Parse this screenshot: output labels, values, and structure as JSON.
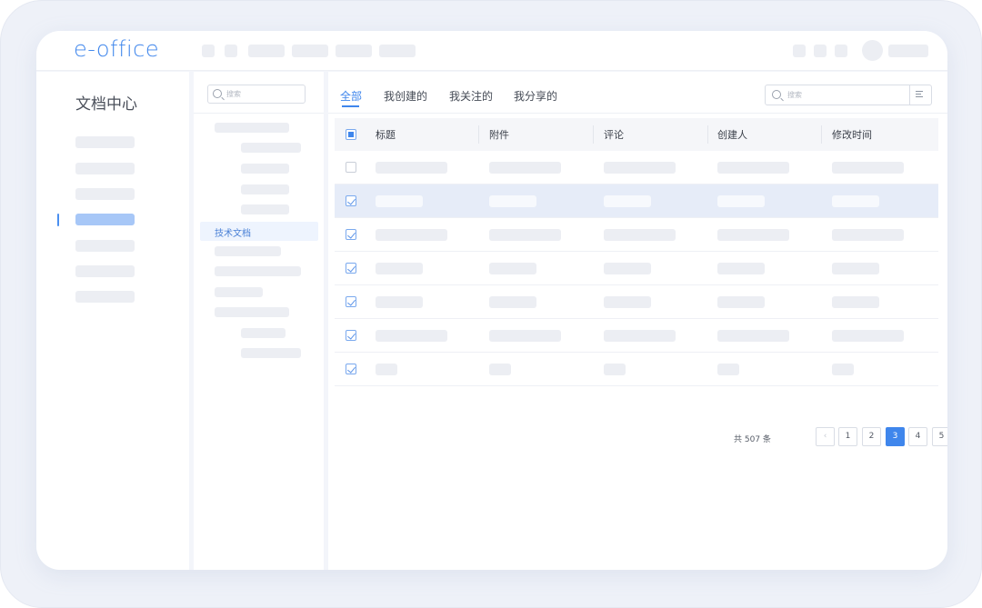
{
  "app": {
    "logo": "e-office"
  },
  "nav": {
    "title": "文档中心"
  },
  "tree": {
    "search_placeholder": "搜索",
    "selected_item": "技术文档"
  },
  "main": {
    "tabs": [
      {
        "label": "全部",
        "active": true
      },
      {
        "label": "我创建的"
      },
      {
        "label": "我关注的"
      },
      {
        "label": "我分享的"
      }
    ],
    "search_placeholder": "搜索"
  },
  "table": {
    "headers": [
      "标题",
      "附件",
      "评论",
      "创建人",
      "修改时间"
    ],
    "rows": [
      {
        "checked": false,
        "selected": false
      },
      {
        "checked": true,
        "selected": true
      },
      {
        "checked": true,
        "selected": false
      },
      {
        "checked": true,
        "selected": false
      },
      {
        "checked": true,
        "selected": false
      },
      {
        "checked": true,
        "selected": false
      },
      {
        "checked": true,
        "selected": false
      }
    ]
  },
  "pagination": {
    "total": "共 507 条",
    "prev": "‹",
    "next": "›",
    "pages": [
      "1",
      "2",
      "3",
      "4",
      "5"
    ],
    "current": "3"
  },
  "colors": {
    "accent": "#3f86ec",
    "selected_row": "#e6ecf8",
    "placeholder_bar": "#eceef3"
  }
}
